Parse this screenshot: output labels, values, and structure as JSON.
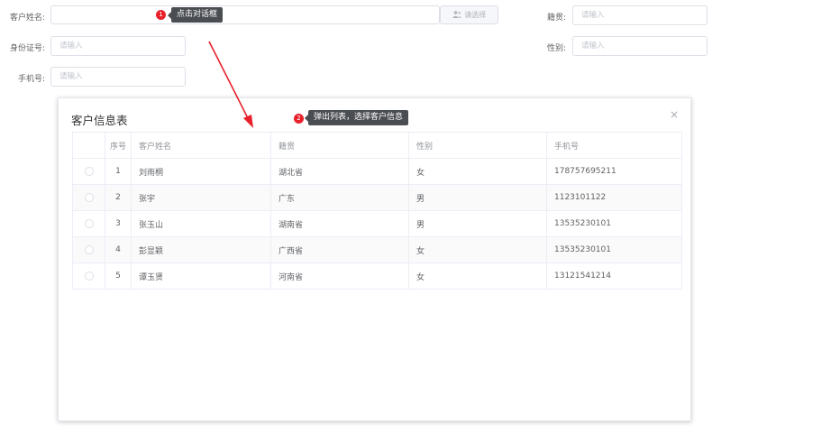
{
  "form": {
    "customer_name_label": "客户姓名:",
    "id_card_label": "身份证号:",
    "phone_label": "手机号:",
    "native_place_label": "籍贯:",
    "gender_label": "性别:",
    "placeholder": "请输入",
    "select_button": "请选择"
  },
  "annotations": {
    "step1_number": "1",
    "step1_text": "点击对话框",
    "step2_number": "2",
    "step2_text": "弹出列表，选择客户信息",
    "arrow_color": "#e8202a"
  },
  "dialog": {
    "title": "客户信息表",
    "close_icon": "×",
    "columns": [
      "",
      "序号",
      "客户姓名",
      "籍贯",
      "性别",
      "手机号"
    ],
    "rows": [
      {
        "index": "1",
        "name": "刘雨桐",
        "native_place": "湖北省",
        "gender": "女",
        "phone": "178757695211"
      },
      {
        "index": "2",
        "name": "张宇",
        "native_place": "广东",
        "gender": "男",
        "phone": "1123101122"
      },
      {
        "index": "3",
        "name": "张玉山",
        "native_place": "湖南省",
        "gender": "男",
        "phone": "13535230101"
      },
      {
        "index": "4",
        "name": "彭显颖",
        "native_place": "广西省",
        "gender": "女",
        "phone": "13535230101"
      },
      {
        "index": "5",
        "name": "谭玉贤",
        "native_place": "河南省",
        "gender": "女",
        "phone": "13121541214"
      }
    ]
  }
}
